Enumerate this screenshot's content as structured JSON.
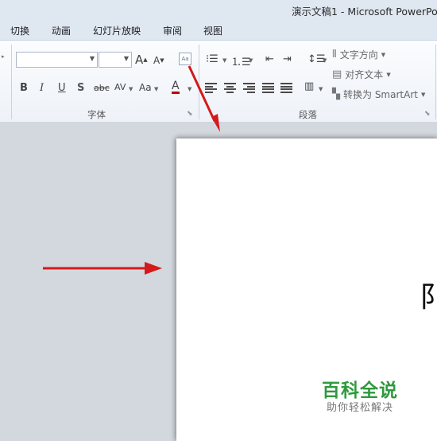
{
  "window": {
    "title": "演示文稿1 - Microsoft PowerPo"
  },
  "tabs": [
    "切换",
    "动画",
    "幻灯片放映",
    "审阅",
    "视图"
  ],
  "ribbon": {
    "font_group": {
      "label": "字体",
      "font_name_value": "",
      "font_size_value": "",
      "buttons": {
        "bold": "B",
        "italic": "I",
        "underline": "U",
        "shadow": "S",
        "strike": "abc",
        "spacing": "AV",
        "case": "Aa",
        "color": "A",
        "grow": "A",
        "shrink": "A"
      }
    },
    "paragraph_group": {
      "label": "段落",
      "text_direction": "文字方向",
      "align_text": "对齐文本",
      "convert_smartart": "转换为 SmartArt"
    }
  },
  "watermark": {
    "main": "百科全说",
    "sub": "助你轻松解决"
  },
  "slide": {
    "partial_text": "阝"
  },
  "colors": {
    "ribbon_bg": "#f4f7fb",
    "titlebar_bg": "#dfe7f1",
    "slide_area_bg": "#d3d8de",
    "arrow": "#d41a1a",
    "watermark_green": "#2e9a3c"
  }
}
